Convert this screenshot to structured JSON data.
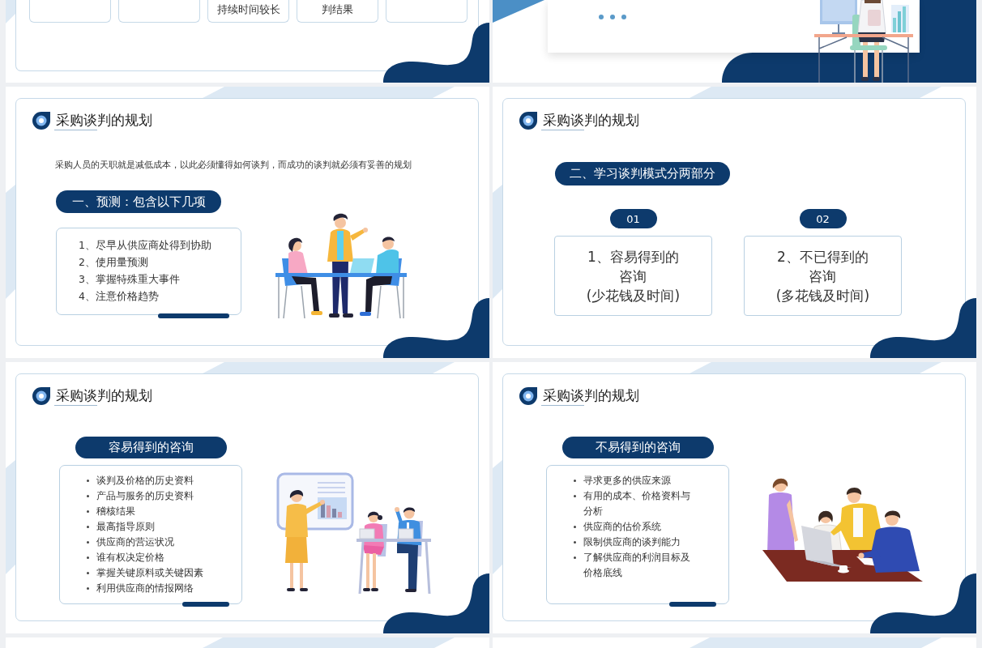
{
  "slides": [
    {
      "kind": "table",
      "cells": [
        {},
        {},
        {
          "text": "持续时间较长"
        },
        {
          "text": "判结果"
        },
        {}
      ]
    },
    {
      "kind": "ending"
    },
    {
      "kind": "forecast",
      "title": "采购谈判的规划",
      "intro": "采购人员的天职就是减低成本，以此必须懂得如何谈判，而成功的谈判就必须有妥善的规划",
      "heading": "一、预测：包含以下几项",
      "items": [
        "1、尽早从供应商处得到协助",
        "2、使用量预测",
        "3、掌握特殊重大事件",
        "4、注意价格趋势"
      ]
    },
    {
      "kind": "parts",
      "title": "采购谈判的规划",
      "heading": "二、学习谈判模式分两部分",
      "parts": [
        {
          "number": "01",
          "lines": [
            "1、容易得到的",
            "咨询",
            "(少花钱及时间)"
          ]
        },
        {
          "number": "02",
          "lines": [
            "2、不已得到的",
            "咨询",
            "(多花钱及时间)"
          ]
        }
      ]
    },
    {
      "kind": "presentation",
      "title": "采购谈判的规划",
      "heading": "容易得到的咨询",
      "items": [
        "谈判及价格的历史资料",
        "产品与服务的历史资料",
        "稽核结果",
        "最高指导原则",
        "供应商的营运状况",
        "谁有权决定价格",
        "掌握关键原料或关键因素",
        "利用供应商的情报网络"
      ]
    },
    {
      "kind": "meeting",
      "title": "采购谈判的规划",
      "heading": "不易得到的咨询",
      "items": [
        "寻求更多的供应来源",
        "有用的成本、价格资料与分析",
        "供应商的估价系统",
        "限制供应商的谈判能力",
        "了解供应商的利润目标及价格底线"
      ]
    },
    {
      "kind": "blank"
    },
    {
      "kind": "blank"
    }
  ]
}
